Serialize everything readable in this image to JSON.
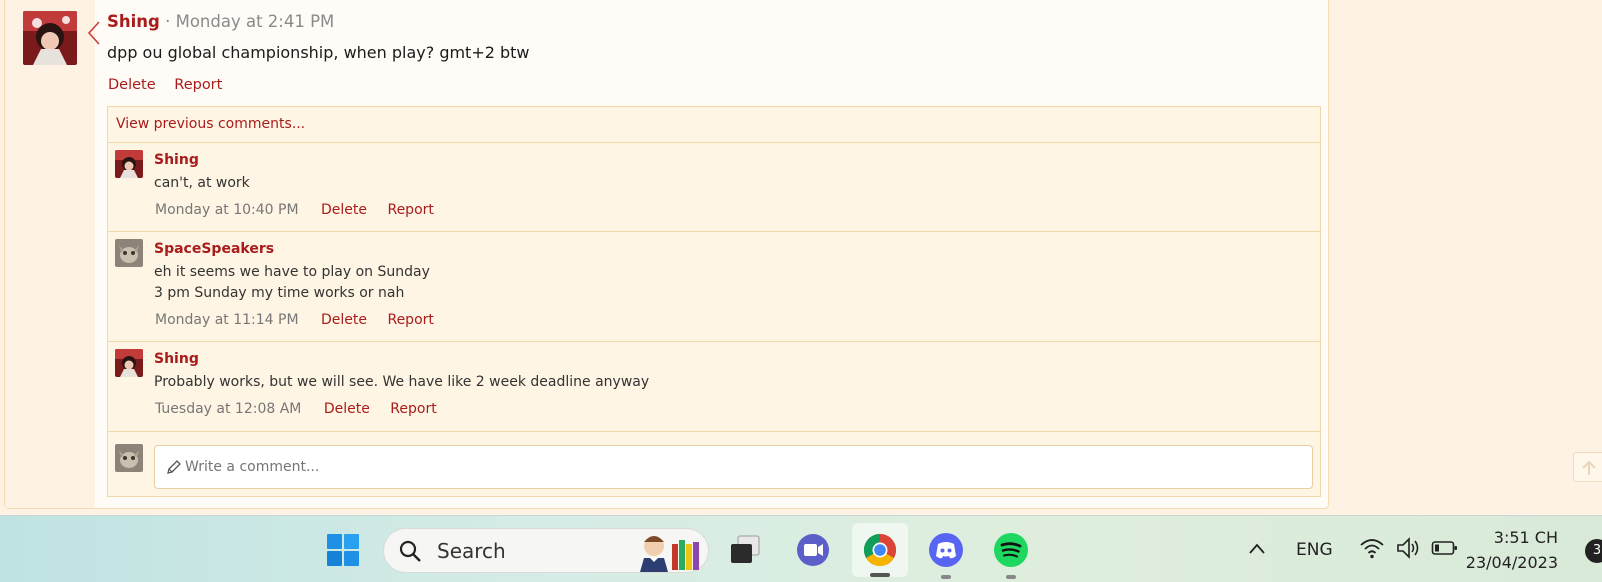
{
  "post": {
    "author": "Shing",
    "separator": "·",
    "time": "Monday at 2:41 PM",
    "body": "dpp ou global championship, when play? gmt+2 btw",
    "actions": {
      "delete": "Delete",
      "report": "Report"
    }
  },
  "comments_section": {
    "view_previous": "View previous comments...",
    "comments": [
      {
        "author": "Shing",
        "lines": [
          "can't, at work"
        ],
        "time": "Monday at 10:40 PM",
        "delete": "Delete",
        "report": "Report"
      },
      {
        "author": "SpaceSpeakers",
        "lines": [
          "eh it seems we have to play on Sunday",
          "3 pm Sunday my time works or nah"
        ],
        "time": "Monday at 11:14 PM",
        "delete": "Delete",
        "report": "Report"
      },
      {
        "author": "Shing",
        "lines": [
          "Probably works, but we will see. We have like 2 week deadline anyway"
        ],
        "time": "Tuesday at 12:08 AM",
        "delete": "Delete",
        "report": "Report"
      }
    ],
    "write_placeholder": "Write a comment..."
  },
  "taskbar": {
    "search_label": "Search",
    "language": "ENG",
    "clock_time": "3:51 CH",
    "clock_date": "23/04/2023",
    "notification_count": "3"
  },
  "colors": {
    "accent": "#a81c1c",
    "page_bg": "#fdf2e4",
    "comment_bg": "#fff5e4"
  },
  "icons": [
    "windows-start-icon",
    "search-icon",
    "task-view-icon",
    "video-call-icon",
    "chrome-icon",
    "discord-icon",
    "spotify-icon",
    "chevron-up-icon",
    "wifi-icon",
    "volume-icon",
    "battery-icon",
    "pencil-icon",
    "scroll-top-icon"
  ]
}
